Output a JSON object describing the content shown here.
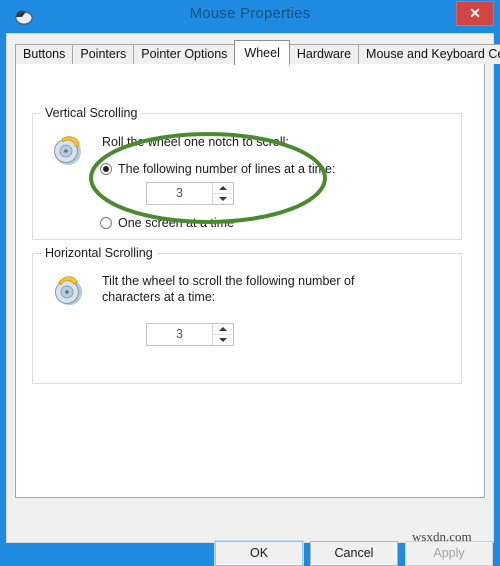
{
  "window": {
    "title": "Mouse Properties",
    "icon": "mouse-icon",
    "close_label": "✕",
    "accent_color": "#1e8ae0",
    "close_color": "#d14545"
  },
  "tabs": [
    {
      "label": "Buttons",
      "active": false
    },
    {
      "label": "Pointers",
      "active": false
    },
    {
      "label": "Pointer Options",
      "active": false
    },
    {
      "label": "Wheel",
      "active": true
    },
    {
      "label": "Hardware",
      "active": false
    },
    {
      "label": "Mouse and Keyboard Center",
      "active": false
    }
  ],
  "vertical_scrolling": {
    "group_title": "Vertical Scrolling",
    "icon": "mouse-wheel-vertical-icon",
    "description": "Roll the wheel one notch to scroll:",
    "options": [
      {
        "label": "The following number of lines at a time:",
        "checked": true
      },
      {
        "label": "One screen at a time",
        "checked": false
      }
    ],
    "spinner": {
      "value": "3",
      "up": "▲",
      "down": "▼"
    }
  },
  "horizontal_scrolling": {
    "group_title": "Horizontal Scrolling",
    "icon": "mouse-wheel-horizontal-icon",
    "description_line1": "Tilt the wheel to scroll the following number of",
    "description_line2": "characters at a time:",
    "spinner": {
      "value": "3",
      "up": "▲",
      "down": "▼"
    }
  },
  "annotation": {
    "shape": "ellipse-highlight",
    "color": "#4b8b30"
  },
  "buttons": {
    "ok": "OK",
    "cancel": "Cancel",
    "apply": "Apply"
  },
  "watermark": "wsxdn.com"
}
